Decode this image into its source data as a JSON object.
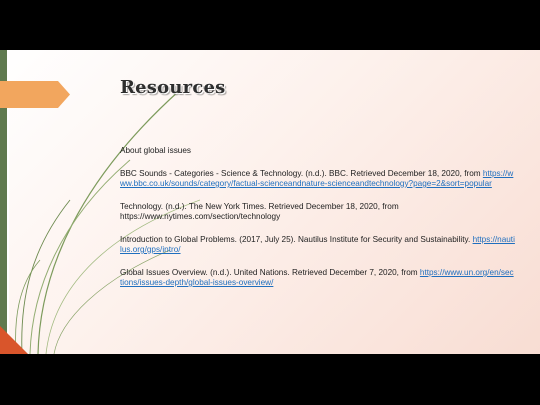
{
  "slide": {
    "title": "Resources",
    "heading": "About global issues",
    "references": [
      {
        "text": "BBC Sounds - Categories - Science & Technology. (n.d.). BBC. Retrieved December 18, 2020, from",
        "link": "https://www.bbc.co.uk/sounds/category/factual-scienceandnature-scienceandtechnology?page=2&sort=popular"
      },
      {
        "text": "Technology. (n.d.). The New York Times. Retrieved December 18, 2020, from https://www.nytimes.com/section/technology",
        "link": ""
      },
      {
        "text": "Introduction to Global Problems. (2017, July 25). Nautilus Institute for Security and Sustainability.",
        "link": "https://nautilus.org/gps/intro/"
      },
      {
        "text": "Global Issues Overview. (n.d.). United Nations. Retrieved December 7, 2020, from",
        "link": "https://www.un.org/en/sections/issues-depth/global-issues-overview/"
      }
    ]
  },
  "colors": {
    "accent_orange": "#f2a65e",
    "accent_green": "#5f7a4f",
    "corner_red": "#d9552b",
    "link": "#1f6fbf"
  }
}
